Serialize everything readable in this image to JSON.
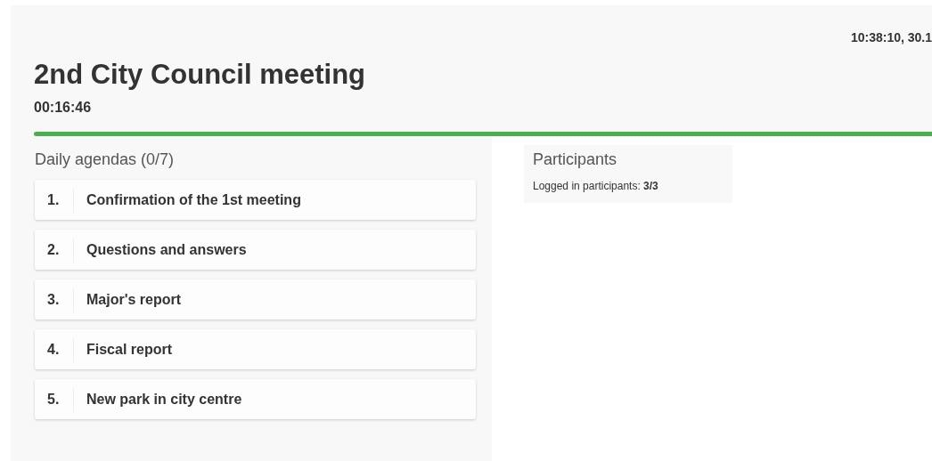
{
  "header": {
    "clock": "10:38:10, 30.1",
    "title": "2nd City Council meeting",
    "elapsed": "00:16:46"
  },
  "agendas": {
    "heading": "Daily agendas (0/7)",
    "items": [
      {
        "number": "1.",
        "title": "Confirmation of the 1st meeting"
      },
      {
        "number": "2.",
        "title": "Questions and answers"
      },
      {
        "number": "3.",
        "title": "Major's report"
      },
      {
        "number": "4.",
        "title": "Fiscal report"
      },
      {
        "number": "5.",
        "title": "New park in city centre"
      }
    ]
  },
  "participants": {
    "heading": "Participants",
    "logged_in": "Logged in participants: **3/3**"
  }
}
